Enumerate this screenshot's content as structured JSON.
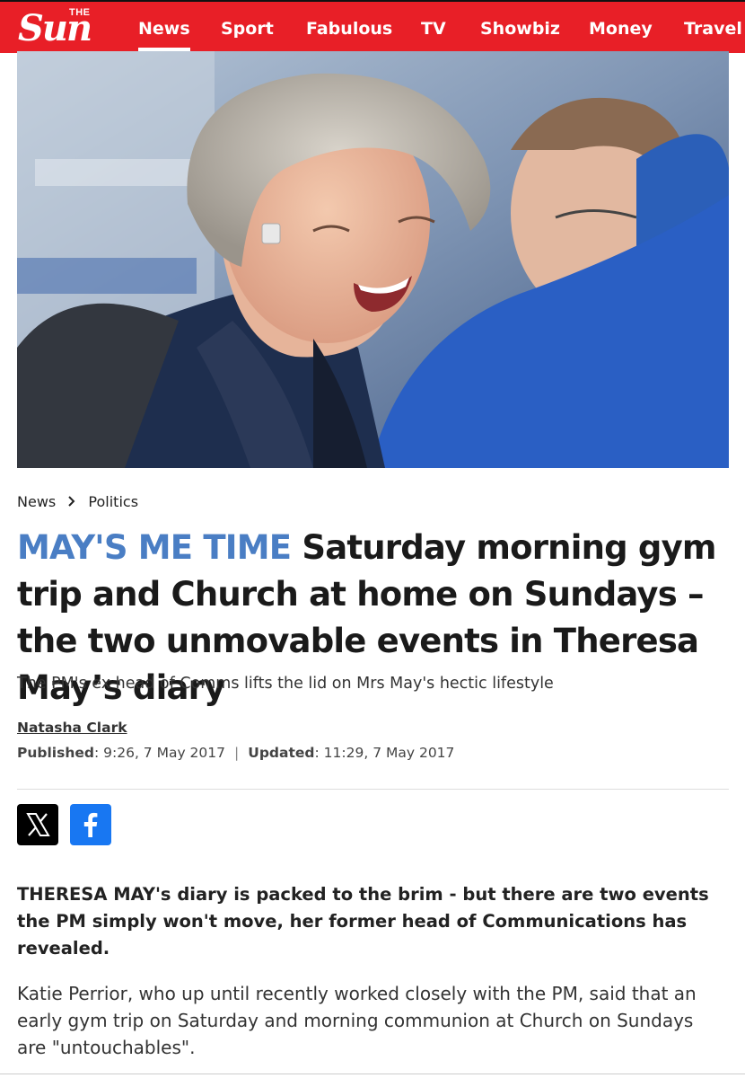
{
  "brand": {
    "the": "THE",
    "name": "Sun",
    "color": "#e81f27"
  },
  "nav": {
    "items": [
      {
        "label": "News",
        "active": true
      },
      {
        "label": "Sport"
      },
      {
        "label": "Fabulous"
      },
      {
        "label": "TV"
      },
      {
        "label": "Showbiz"
      },
      {
        "label": "Money"
      },
      {
        "label": "Travel"
      }
    ]
  },
  "hero": {
    "icon": "photo-of-smiling-woman"
  },
  "breadcrumb": {
    "section": "News",
    "separator_icon": "chevron-right-icon",
    "subsection": "Politics"
  },
  "article": {
    "kicker": "MAY'S ME TIME",
    "headline": "Saturday morning gym trip and Church at home on Sundays – the two unmovable events in Theresa May’s diary",
    "standfirst": "The PM's ex head of Comms lifts the lid on Mrs May's hectic lifestyle",
    "author": "Natasha Clark",
    "published_label": "Published",
    "published": "9:26, 7 May 2017",
    "separator": "|",
    "updated_label": "Updated",
    "updated": "11:29, 7 May 2017",
    "lead": "THERESA MAY's diary is packed to the brim - but there are two events the PM simply won't move, her former head of Communications has revealed.",
    "body": "Katie Perrior, who up until recently worked closely with the PM, said that an early gym trip on Saturday and morning communion at Church on Sundays are \"untouchables\"."
  },
  "share": {
    "x_icon": "x-logo-icon",
    "facebook_icon": "facebook-icon",
    "facebook_color": "#1877f2",
    "x_color": "#000000"
  },
  "accent": {
    "kicker_color": "#4a7ec4"
  }
}
